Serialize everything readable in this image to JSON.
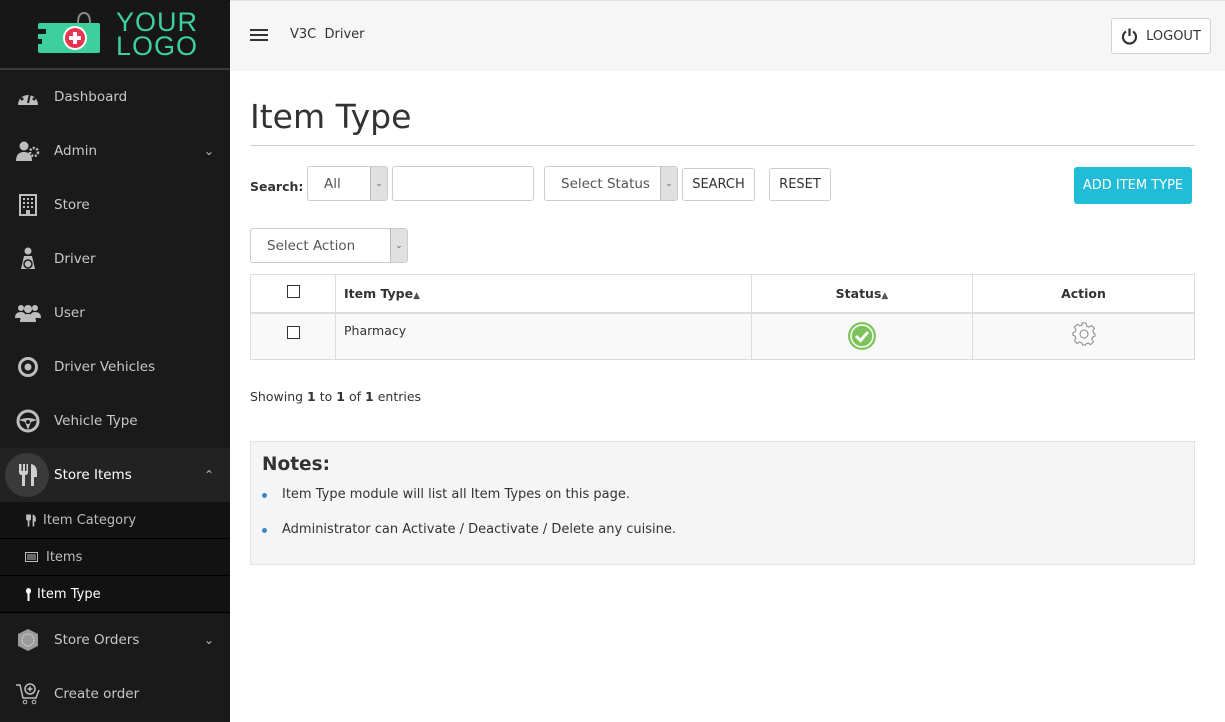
{
  "logo": {
    "line1": "YOUR",
    "line2": "LOGO",
    "color": "#3ecf9e"
  },
  "sidebar": {
    "items": [
      {
        "label": "Dashboard",
        "icon": "dashboard-icon"
      },
      {
        "label": "Admin",
        "icon": "admin-icon",
        "expandable": true
      },
      {
        "label": "Store",
        "icon": "building-icon"
      },
      {
        "label": "Driver",
        "icon": "driver-icon"
      },
      {
        "label": "User",
        "icon": "users-icon"
      },
      {
        "label": "Driver Vehicles",
        "icon": "target-icon"
      },
      {
        "label": "Vehicle Type",
        "icon": "steering-wheel-icon"
      },
      {
        "label": "Store Items",
        "icon": "cutlery-icon",
        "expanded": true
      },
      {
        "label": "Store Orders",
        "icon": "orders-icon",
        "expandable": true
      },
      {
        "label": "Create order",
        "icon": "cart-plus-icon"
      }
    ],
    "submenu": [
      {
        "label": "Item Category",
        "icon": "cutlery-icon"
      },
      {
        "label": "Items",
        "icon": "list-icon"
      },
      {
        "label": "Item Type",
        "icon": "spoon-icon",
        "current": true
      }
    ]
  },
  "topbar": {
    "title": "V3C  Driver",
    "logout_label": "LOGOUT"
  },
  "page": {
    "title": "Item Type"
  },
  "filters": {
    "search_label": "Search:",
    "field_select": "All",
    "search_value": "",
    "status_select": "Select Status",
    "search_button": "SEARCH",
    "reset_button": "RESET",
    "add_button": "ADD ITEM TYPE",
    "action_select": "Select Action"
  },
  "table": {
    "columns": [
      "Item Type",
      "Status",
      "Action"
    ],
    "rows": [
      {
        "item_type": "Pharmacy",
        "status": "active"
      }
    ]
  },
  "pagination": {
    "prefix": "Showing",
    "from": "1",
    "to_word": "to",
    "to": "1",
    "of_word": "of",
    "total": "1",
    "suffix": "entries"
  },
  "notes": {
    "title": "Notes:",
    "items": [
      "Item Type module will list all Item Types on this page.",
      "Administrator can Activate / Deactivate / Delete any cuisine."
    ]
  },
  "colors": {
    "accent": "#21bcd8",
    "status_active": "#7cc45a",
    "sidebar_bg": "#1a1a1a"
  }
}
